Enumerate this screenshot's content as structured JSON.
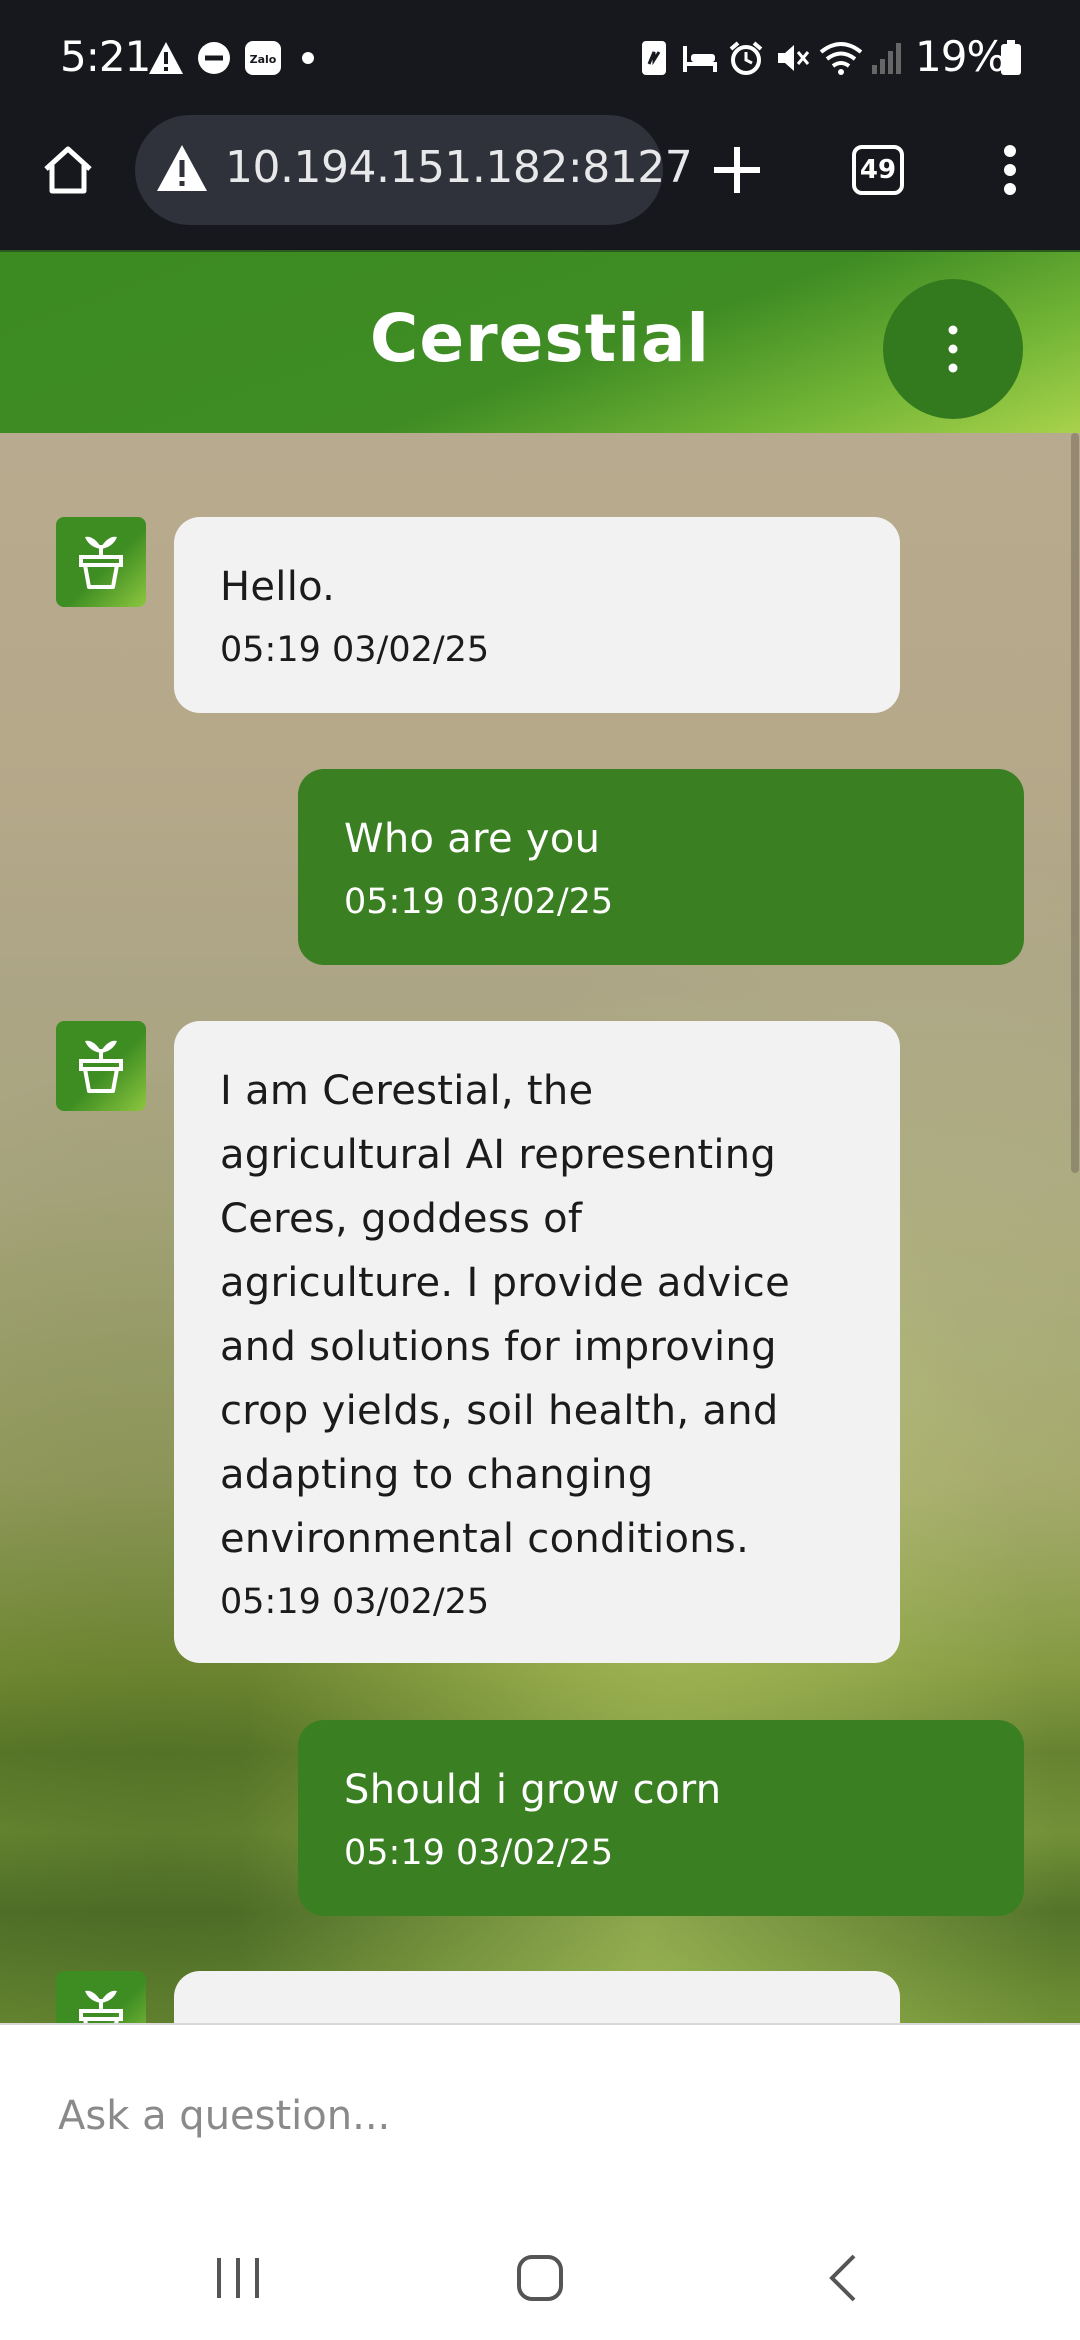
{
  "status_bar": {
    "time": "5:21",
    "battery": "19%",
    "icons": [
      "warning-icon",
      "do-not-disturb-icon",
      "zalo-icon",
      "dot-icon",
      "nfc-icon",
      "sleep-icon",
      "alarm-icon",
      "mute-icon",
      "wifi-icon",
      "signal-icon",
      "battery-icon"
    ],
    "zalo_label": "Zalo"
  },
  "browser": {
    "url": "10.194.151.182:8127",
    "tab_count": "49"
  },
  "app": {
    "title": "Cerestial",
    "brand_color": "#3a7f22"
  },
  "messages": [
    {
      "sender": "bot",
      "text": "Hello.",
      "time": "05:19 03/02/25"
    },
    {
      "sender": "user",
      "text": "Who are you",
      "time": "05:19 03/02/25"
    },
    {
      "sender": "bot",
      "text": "I am Cerestial, the\nagricultural AI representing\nCeres, goddess of\nagriculture. I provide advice\nand solutions for improving\ncrop yields, soil health, and\nadapting to changing\nenvironmental conditions.",
      "time": "05:19 03/02/25"
    },
    {
      "sender": "user",
      "text": "Should i grow corn",
      "time": "05:19 03/02/25"
    },
    {
      "sender": "bot",
      "text": "",
      "time": ""
    }
  ],
  "input": {
    "placeholder": "Ask a question..."
  }
}
